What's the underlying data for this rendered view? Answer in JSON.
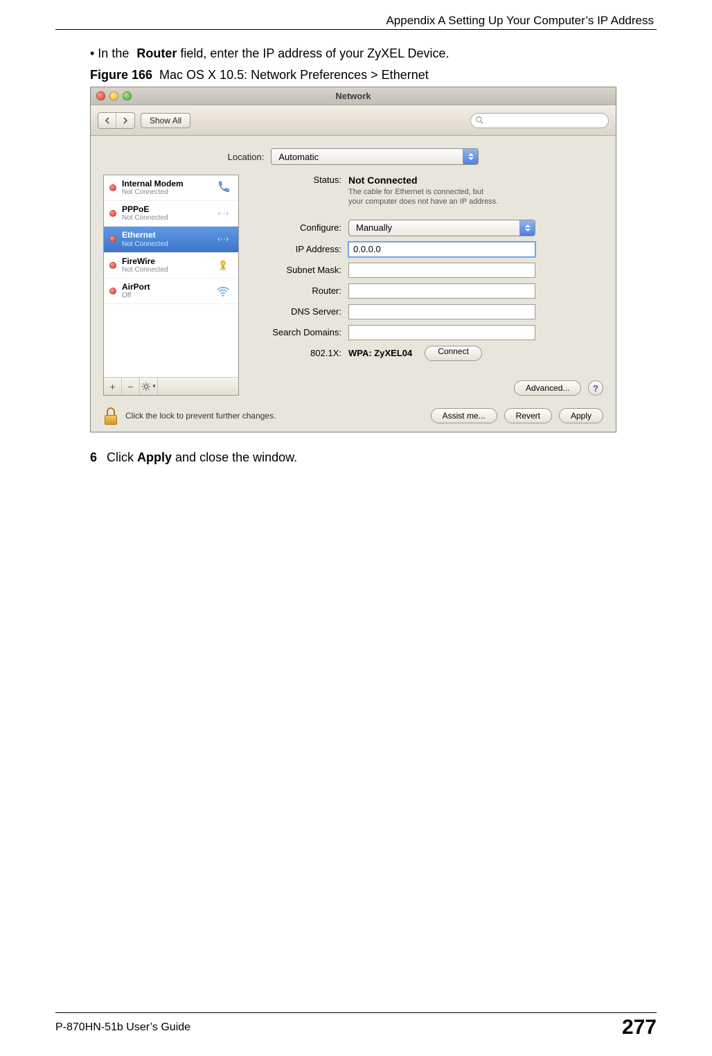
{
  "header": {
    "title": "Appendix A Setting Up Your Computer’s IP Address"
  },
  "body": {
    "bullet_prefix": "• In the ",
    "bullet_bold": "Router",
    "bullet_suffix": " field, enter the IP address of your ZyXEL Device.",
    "figure_label": "Figure 166",
    "figure_caption": "Mac OS X 10.5: Network Preferences > Ethernet",
    "step_num": "6",
    "step_prefix": "Click ",
    "step_bold": "Apply",
    "step_suffix": " and close the window."
  },
  "window": {
    "title": "Network",
    "toolbar": {
      "show_all": "Show All"
    },
    "location_label": "Location:",
    "location_value": "Automatic",
    "services": [
      {
        "name": "Internal Modem",
        "sub": "Not Connected"
      },
      {
        "name": "PPPoE",
        "sub": "Not Connected"
      },
      {
        "name": "Ethernet",
        "sub": "Not Connected"
      },
      {
        "name": "FireWire",
        "sub": "Not Connected"
      },
      {
        "name": "AirPort",
        "sub": "Off"
      }
    ],
    "detail": {
      "status_label": "Status:",
      "status_value": "Not Connected",
      "status_desc1": "The cable for Ethernet is connected, but",
      "status_desc2": "your computer does not have an IP address.",
      "configure_label": "Configure:",
      "configure_value": "Manually",
      "ip_label": "IP Address:",
      "ip_value": "0.0.0.0",
      "subnet_label": "Subnet Mask:",
      "router_label": "Router:",
      "dns_label": "DNS Server:",
      "search_label": "Search Domains:",
      "wpa_label": "802.1X:",
      "wpa_value": "WPA: ZyXEL04",
      "connect": "Connect",
      "advanced": "Advanced...",
      "help": "?"
    },
    "lock_text": "Click the lock to prevent further changes.",
    "buttons": {
      "assist": "Assist me...",
      "revert": "Revert",
      "apply": "Apply"
    }
  },
  "footer": {
    "guide": "P-870HN-51b User’s Guide",
    "page": "277"
  }
}
